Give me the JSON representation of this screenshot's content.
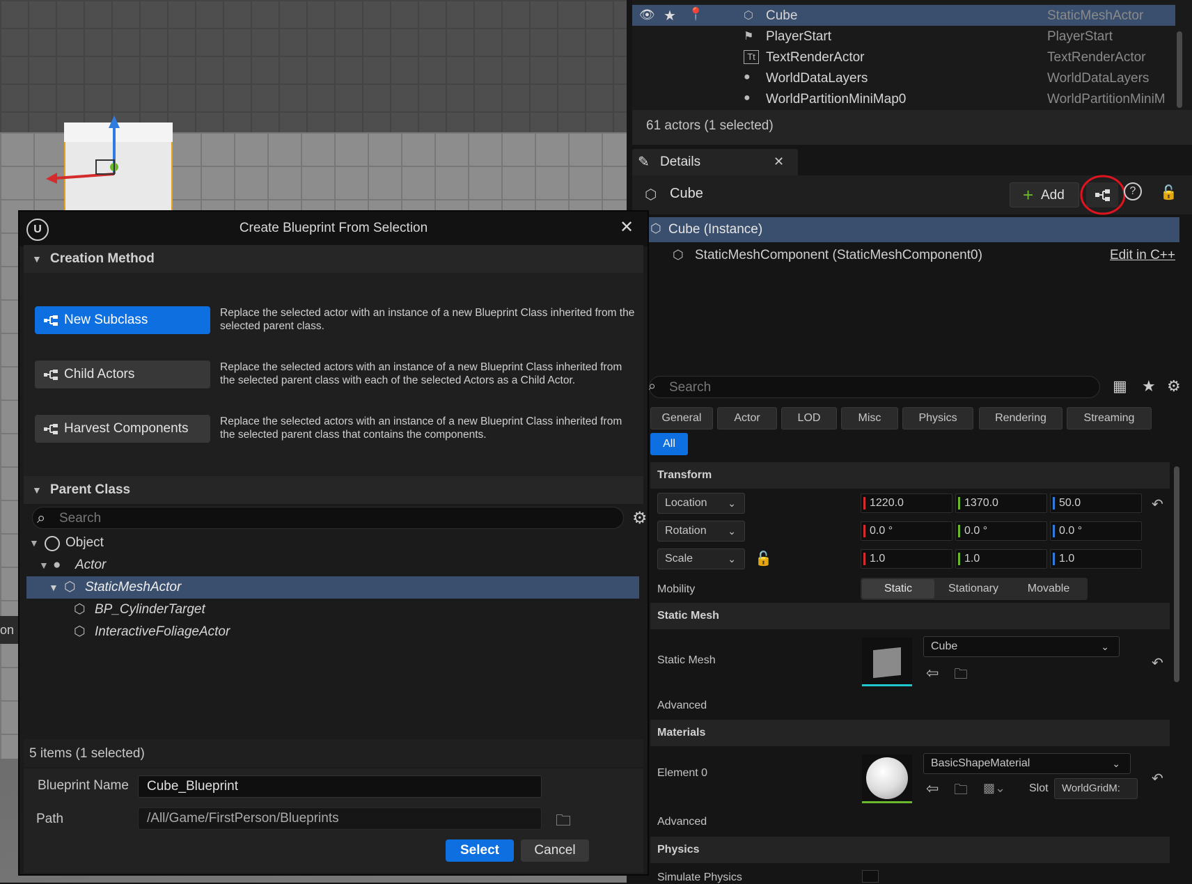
{
  "outliner": {
    "rows": [
      {
        "name": "Cube",
        "type": "StaticMeshActor"
      },
      {
        "name": "PlayerStart",
        "type": "PlayerStart"
      },
      {
        "name": "TextRenderActor",
        "type": "TextRenderActor"
      },
      {
        "name": "WorldDataLayers",
        "type": "WorldDataLayers"
      },
      {
        "name": "WorldPartitionMiniMap0",
        "type": "WorldPartitionMiniM"
      }
    ],
    "status": "61 actors (1 selected)"
  },
  "details": {
    "tab_label": "Details",
    "actor_name": "Cube",
    "add_label": "Add",
    "instance_label": "Cube (Instance)",
    "component_label": "StaticMeshComponent (StaticMeshComponent0)",
    "edit_cpp": "Edit in C++",
    "search_placeholder": "Search",
    "filter_tabs": [
      "General",
      "Actor",
      "LOD",
      "Misc",
      "Physics",
      "Rendering",
      "Streaming"
    ],
    "all_tab": "All",
    "transform": {
      "section": "Transform",
      "location_label": "Location",
      "rotation_label": "Rotation",
      "scale_label": "Scale",
      "location": [
        "1220.0",
        "1370.0",
        "50.0"
      ],
      "rotation": [
        "0.0 °",
        "0.0 °",
        "0.0 °"
      ],
      "scale": [
        "1.0",
        "1.0",
        "1.0"
      ],
      "mobility_label": "Mobility",
      "mobility_options": [
        "Static",
        "Stationary",
        "Movable"
      ]
    },
    "static_mesh": {
      "section": "Static Mesh",
      "label": "Static Mesh",
      "value": "Cube",
      "advanced": "Advanced"
    },
    "materials": {
      "section": "Materials",
      "element_label": "Element 0",
      "value": "BasicShapeMaterial",
      "slot_label": "Slot",
      "slot_value": "WorldGridM:",
      "advanced": "Advanced"
    },
    "physics": {
      "section": "Physics",
      "simulate_label": "Simulate Physics"
    }
  },
  "dialog": {
    "title": "Create Blueprint From Selection",
    "creation_method": "Creation Method",
    "methods": [
      {
        "label": "New Subclass",
        "desc": "Replace the selected actor with an instance of a new Blueprint Class inherited from the selected parent class."
      },
      {
        "label": "Child Actors",
        "desc": "Replace the selected actors with an instance of a new Blueprint Class inherited from the selected parent class with each of the selected Actors as a Child Actor."
      },
      {
        "label": "Harvest Components",
        "desc": "Replace the selected actors with an instance of a new Blueprint Class inherited from the selected parent class that contains the components."
      }
    ],
    "parent_class": "Parent Class",
    "search_placeholder": "Search",
    "tree": [
      "Object",
      "Actor",
      "StaticMeshActor",
      "BP_CylinderTarget",
      "InteractiveFoliageActor"
    ],
    "items_status": "5 items (1 selected)",
    "blueprint_name_label": "Blueprint Name",
    "blueprint_name": "Cube_Blueprint",
    "path_label": "Path",
    "path": "/All/Game/FirstPerson/Blueprints",
    "select_label": "Select",
    "cancel_label": "Cancel"
  },
  "viewport": {
    "side_text": "on"
  },
  "colors": {
    "accent": "#0e70e0",
    "selection": "#3a4f6e",
    "highlight_circle": "#e0141e",
    "x_axis": "#d42c2c",
    "y_axis": "#6bb82f",
    "z_axis": "#2f7be0"
  }
}
